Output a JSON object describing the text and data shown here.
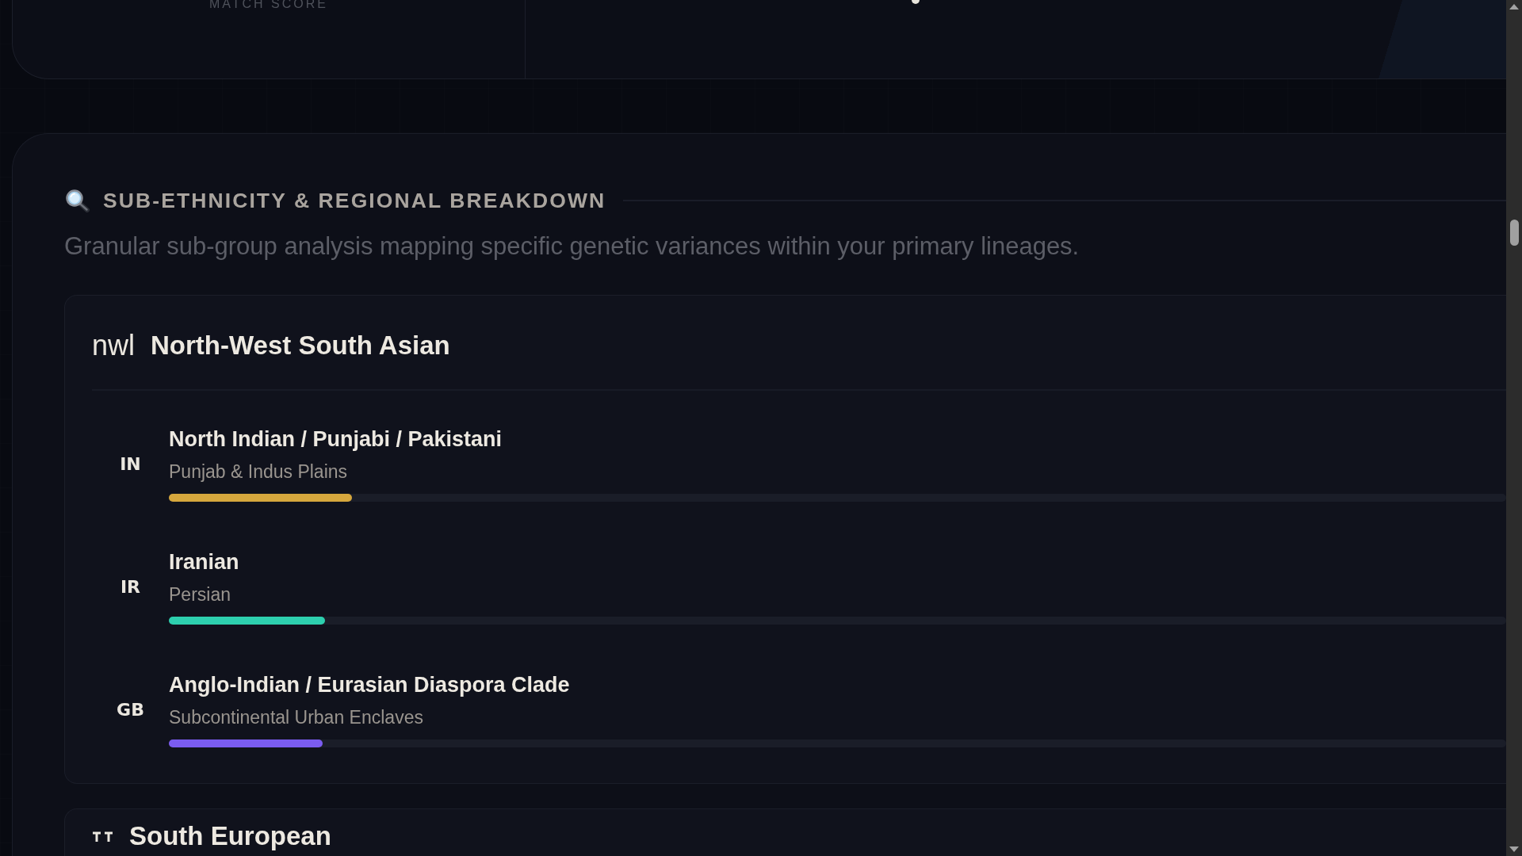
{
  "score_panel": {
    "label": "MATCH SCORE"
  },
  "section": {
    "title": "SUB-ETHNICITY & REGIONAL BREAKDOWN",
    "description": "Granular sub-group analysis mapping specific genetic variances within your primary lineages.",
    "groups": [
      {
        "code": "nwl",
        "name": "North-West South Asian",
        "subgroups": [
          {
            "code": "IN",
            "name": "North Indian / Punjabi / Pakistani",
            "region": "Punjab & Indus Plains",
            "level": 0.137,
            "color": "#d6a73d"
          },
          {
            "code": "IR",
            "name": "Iranian",
            "region": "Persian",
            "level": 0.117,
            "color": "#2dcfae"
          },
          {
            "code": "GB",
            "name": "Anglo-Indian / Eurasian Diaspora Clade",
            "region": "Subcontinental Urban Enclaves",
            "level": 0.115,
            "color": "#7b5cf0"
          }
        ]
      },
      {
        "name": "South European"
      }
    ]
  }
}
